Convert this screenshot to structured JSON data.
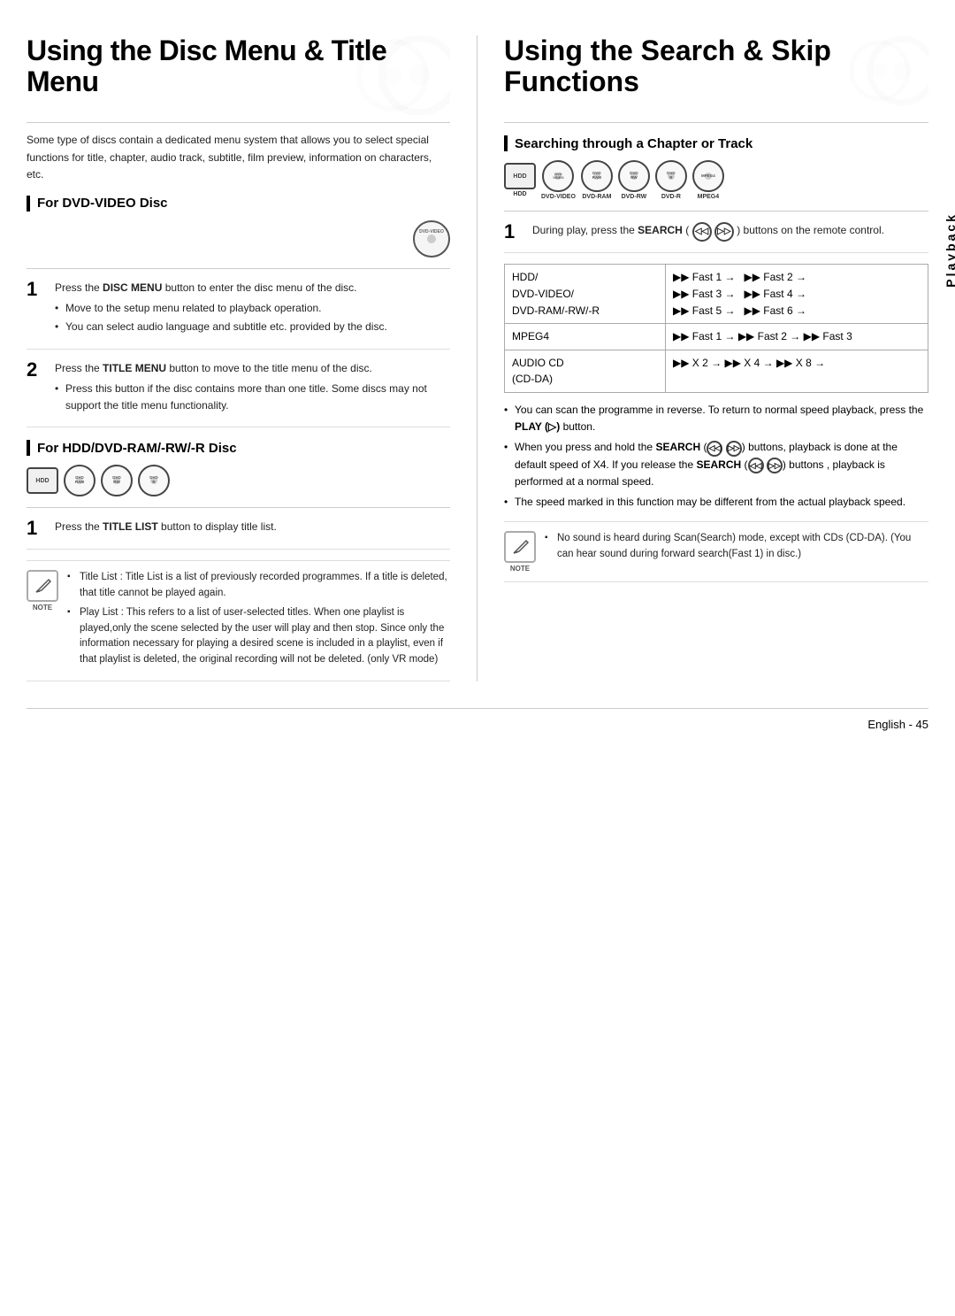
{
  "left": {
    "title": "Using the Disc Menu & Title Menu",
    "intro": "Some type of discs contain a dedicated menu system that allows you to select special functions for title, chapter, audio track, subtitle, film preview, information on characters, etc.",
    "section1": {
      "header": "For DVD-VIDEO Disc",
      "step1": {
        "number": "1",
        "text": "Press the ",
        "bold": "DISC MENU",
        "text2": " button to enter the disc menu of the disc.",
        "bullets": [
          "Move to the setup menu related to playback operation.",
          "You can select audio language and subtitle etc. provided by the disc."
        ]
      },
      "step2": {
        "number": "2",
        "text": "Press the ",
        "bold": "TITLE MENU",
        "text2": " button to move to the title menu of the disc.",
        "bullets": [
          "Press this button if the disc contains more than one title. Some discs may not support the title menu functionality."
        ]
      }
    },
    "section2": {
      "header": "For HDD/DVD-RAM/-RW/-R Disc",
      "step1": {
        "number": "1",
        "text": "Press the ",
        "bold": "TITLE LIST",
        "text2": " button to display title list."
      }
    },
    "note": {
      "items": [
        "Title List : Title List is a list of previously recorded programmes. If a title is deleted, that title cannot be played again.",
        "Play List : This refers to a list of user-selected titles. When one playlist is played,only the scene selected by the user will play and then stop. Since only the information necessary for playing a desired scene is included in a playlist, even if that playlist is deleted, the original recording will not be deleted. (only VR mode)"
      ]
    }
  },
  "right": {
    "title": "Using the Search & Skip Functions",
    "section1": {
      "header": "Searching through a Chapter or Track",
      "disc_labels": [
        "HDD",
        "DVD-VIDEO",
        "DVD-RAM",
        "DVD-RW",
        "DVD-R",
        "MPEG4"
      ],
      "step1": {
        "number": "1",
        "text": "During play, press the ",
        "bold": "SEARCH",
        "text2": " (◁◁  ▷▷) buttons on the remote control."
      },
      "table": {
        "rows": [
          {
            "label": "HDD/\nDVD-VIDEO/\nDVD-RAM/-RW/-R",
            "value": "▶▶ Fast 1 →    ▶▶ Fast 2 →\n▶▶ Fast 3 →    ▶▶ Fast 4 →\n▶▶ Fast 5 →    ▶▶ Fast 6 →"
          },
          {
            "label": "MPEG4",
            "value": "▶▶ Fast 1 → ▶▶ Fast 2 → ▶▶ Fast 3"
          },
          {
            "label": "AUDIO CD\n(CD-DA)",
            "value": "▶▶ X 2 → ▶▶ X 4 → ▶▶ X 8 →"
          }
        ]
      },
      "bullets": [
        "You can scan the programme in reverse. To return to normal speed playback, press the PLAY (▷) button.",
        "When you press and hold the SEARCH (◁◁ ▷▷) buttons, playback is done at the default speed of X4. If you release the SEARCH (◁◁ ▷▷) buttons , playback is performed at a normal speed.",
        "The speed marked in this function may be different from the actual playback speed."
      ],
      "note": {
        "items": [
          "No sound is heard during Scan(Search) mode, except with CDs (CD-DA). (You can hear sound during forward search(Fast 1) in disc.)"
        ]
      }
    }
  },
  "footer": {
    "text": "English - 45"
  },
  "playback_label": "Playback"
}
